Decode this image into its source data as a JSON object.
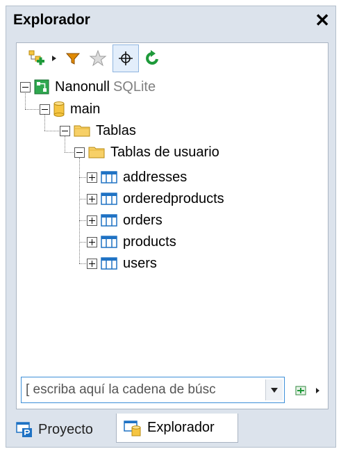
{
  "window": {
    "title": "Explorador",
    "close_label": "✕"
  },
  "toolbar": {
    "buttons": [
      {
        "name": "add-connection-button",
        "icon": "add-db-icon"
      },
      {
        "name": "dropdown-arrow-button",
        "icon": "triangle-right-icon"
      },
      {
        "name": "filter-button",
        "icon": "funnel-icon"
      },
      {
        "name": "favorites-button",
        "icon": "star-icon"
      },
      {
        "name": "locate-button",
        "icon": "crosshair-icon",
        "active": true
      },
      {
        "name": "refresh-button",
        "icon": "refresh-icon"
      }
    ]
  },
  "tree": {
    "connection": {
      "label": "Nanonull",
      "type_label": "SQLite"
    },
    "database": {
      "label": "main"
    },
    "tables_folder": {
      "label": "Tablas"
    },
    "user_tables_folder": {
      "label": "Tablas de usuario"
    },
    "tables": [
      {
        "label": "addresses"
      },
      {
        "label": "orderedproducts"
      },
      {
        "label": "orders"
      },
      {
        "label": "products"
      },
      {
        "label": "users"
      }
    ]
  },
  "search": {
    "placeholder": "[ escriba aquí la cadena de búsc"
  },
  "tabs": [
    {
      "label": "Proyecto",
      "active": false
    },
    {
      "label": "Explorador",
      "active": true
    }
  ],
  "colors": {
    "accent_blue": "#1f72c4",
    "folder_yellow": "#f5c542",
    "refresh_green": "#1e9a3a",
    "filter_orange": "#e08a00"
  }
}
